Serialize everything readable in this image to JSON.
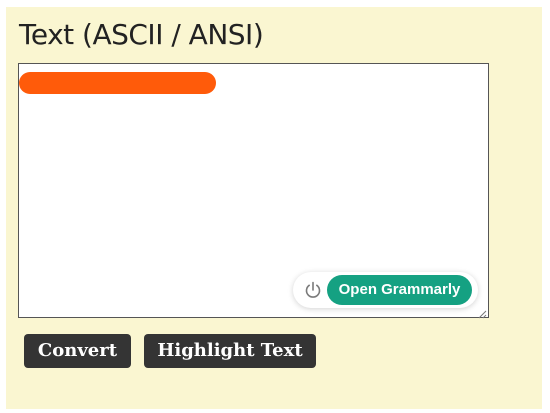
{
  "section": {
    "title": "Text (ASCII / ANSI)"
  },
  "editor": {
    "value": "",
    "redaction_color": "#ff5b0a"
  },
  "grammarly": {
    "power_icon": "power-icon",
    "open_label": "Open Grammarly",
    "accent": "#15a182"
  },
  "actions": {
    "convert_label": "Convert",
    "highlight_label": "Highlight Text"
  },
  "colors": {
    "panel_background": "#faf6d1",
    "button_background": "#343434"
  }
}
